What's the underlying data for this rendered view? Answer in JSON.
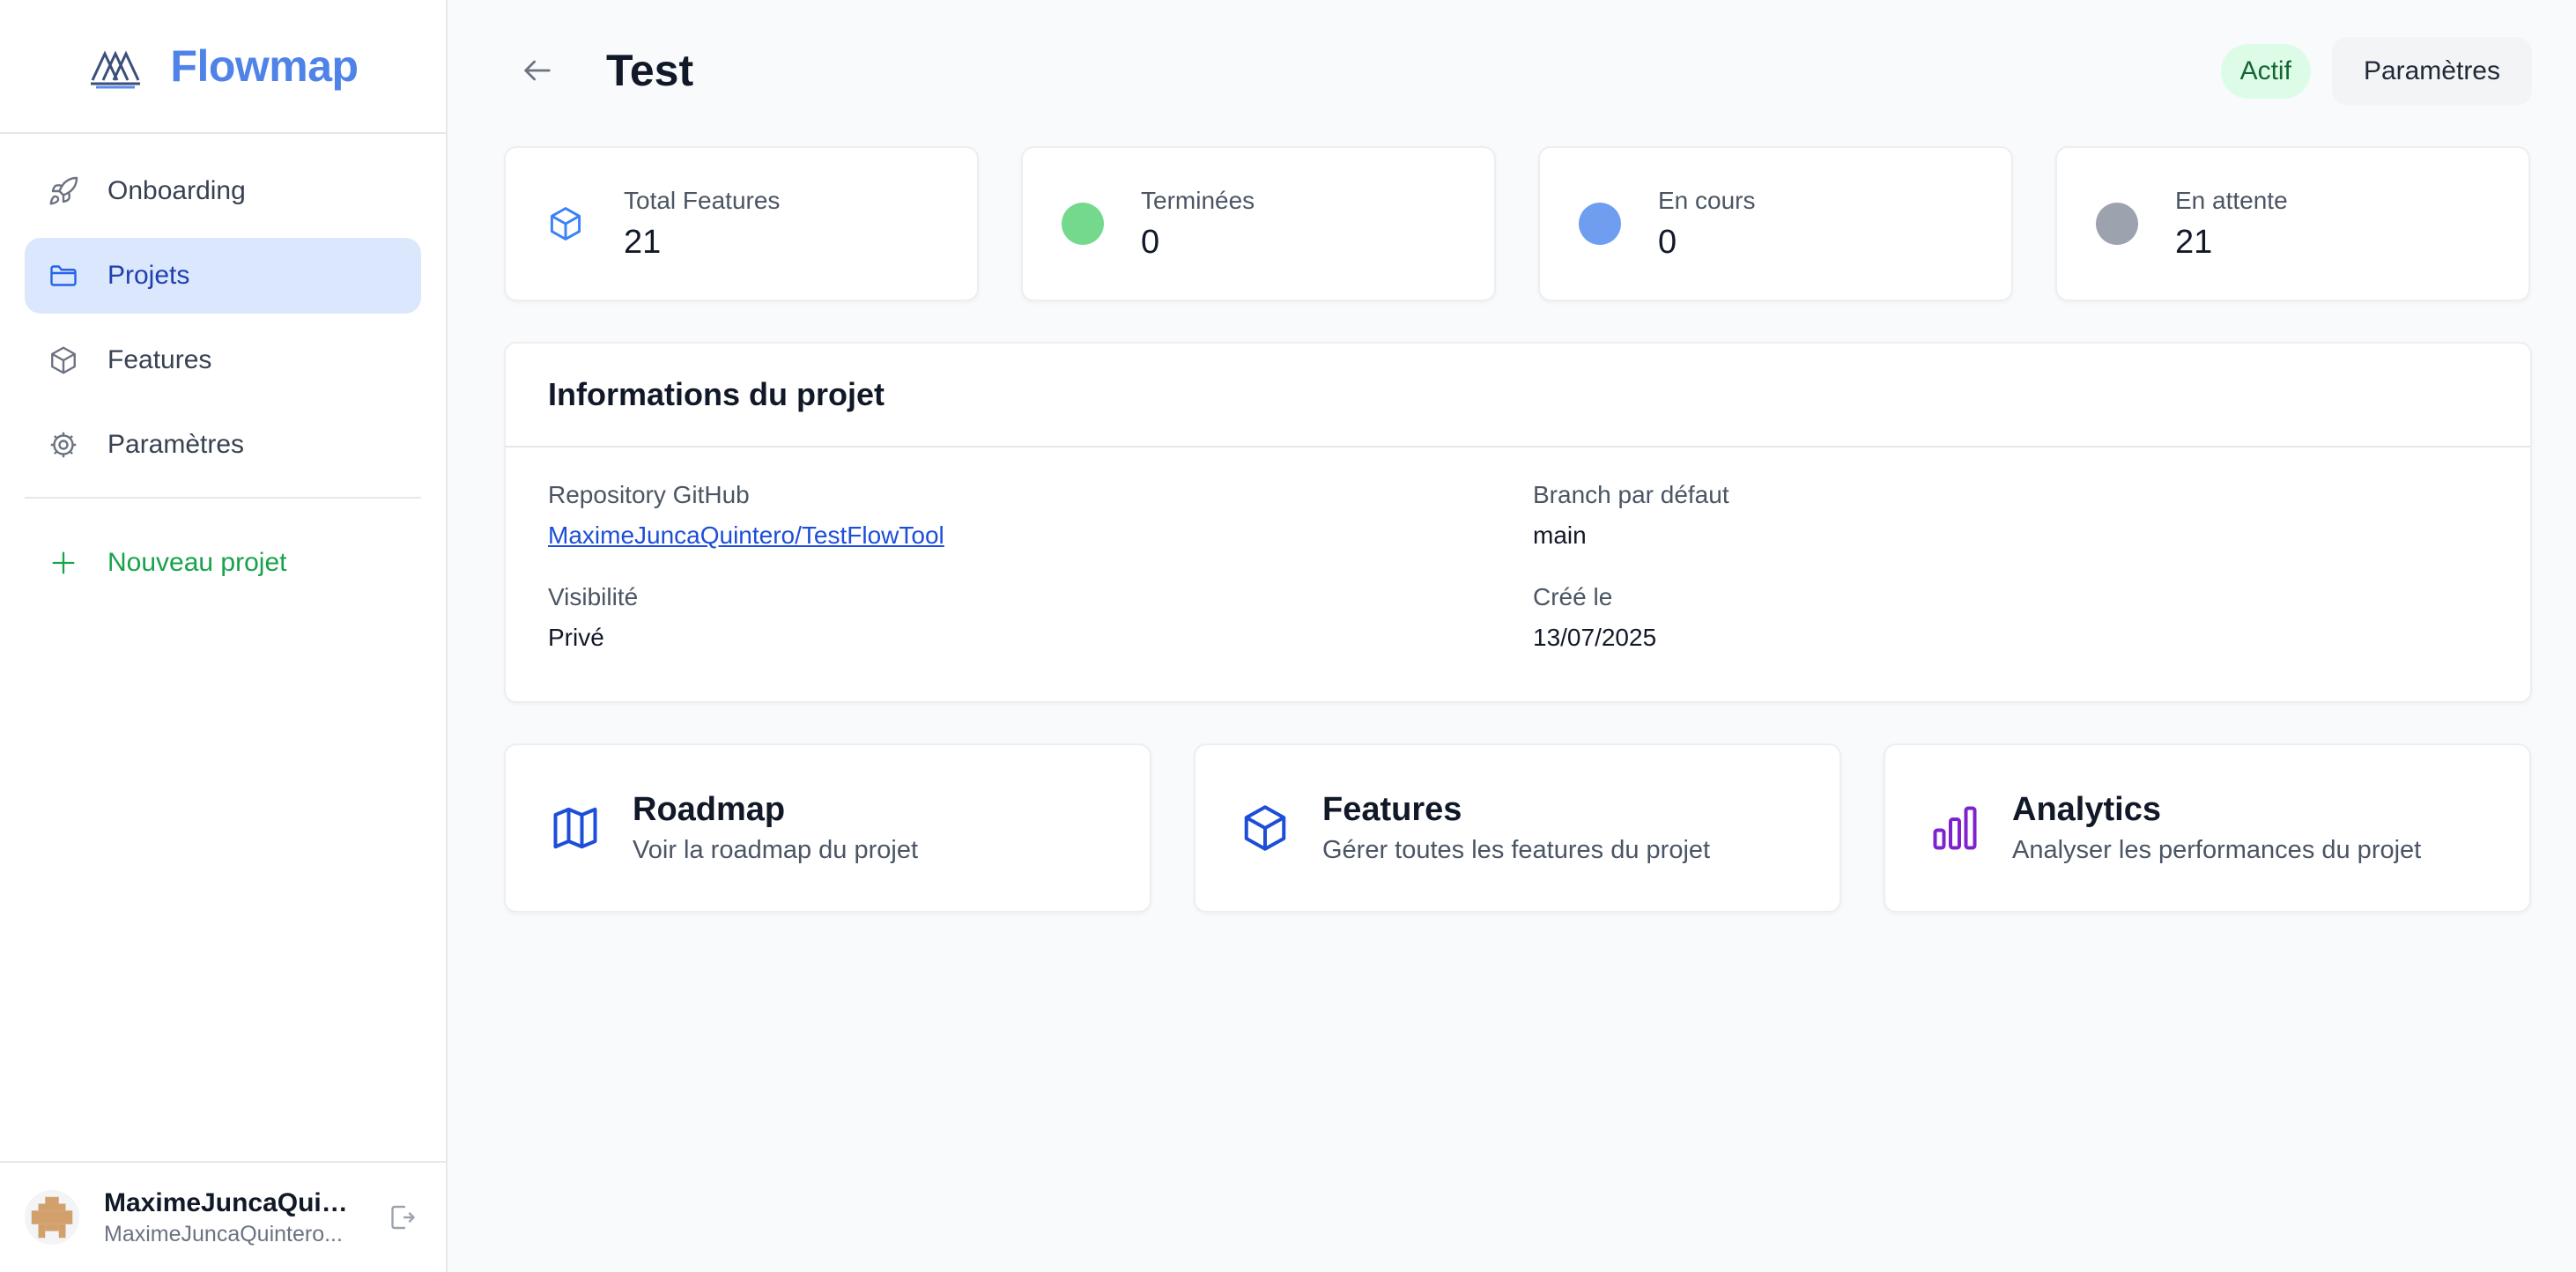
{
  "app": {
    "name": "Flowmap",
    "brand_color": "#4f83e8"
  },
  "sidebar": {
    "items": [
      {
        "label": "Onboarding",
        "icon": "rocket-icon",
        "active": false
      },
      {
        "label": "Projets",
        "icon": "folder-icon",
        "active": true
      },
      {
        "label": "Features",
        "icon": "cube-icon",
        "active": false
      },
      {
        "label": "Paramètres",
        "icon": "gear-icon",
        "active": false
      }
    ],
    "new_project": {
      "label": "Nouveau projet",
      "icon": "plus-icon",
      "color": "#16a34a"
    }
  },
  "user": {
    "name": "MaximeJuncaQuin...",
    "email": "MaximeJuncaQuintero...",
    "logout_icon": "logout-icon"
  },
  "header": {
    "title": "Test",
    "status_badge": "Actif",
    "settings_button": "Paramètres"
  },
  "stats": [
    {
      "label": "Total Features",
      "value": "21",
      "icon": "cube-icon"
    },
    {
      "label": "Terminées",
      "value": "0",
      "color": "#74d98d"
    },
    {
      "label": "En cours",
      "value": "0",
      "color": "#6f9ef1"
    },
    {
      "label": "En attente",
      "value": "21",
      "color": "#9ca3af"
    }
  ],
  "info": {
    "title": "Informations du projet",
    "repo_label": "Repository GitHub",
    "repo_value": "MaximeJuncaQuintero/TestFlowTool",
    "branch_label": "Branch par défaut",
    "branch_value": "main",
    "visibility_label": "Visibilité",
    "visibility_value": "Privé",
    "created_label": "Créé le",
    "created_value": "13/07/2025"
  },
  "cards": [
    {
      "title": "Roadmap",
      "desc": "Voir la roadmap du projet",
      "icon": "map-icon"
    },
    {
      "title": "Features",
      "desc": "Gérer toutes les features du projet",
      "icon": "cube-icon"
    },
    {
      "title": "Analytics",
      "desc": "Analyser les performances du projet",
      "icon": "bar-chart-icon"
    }
  ]
}
